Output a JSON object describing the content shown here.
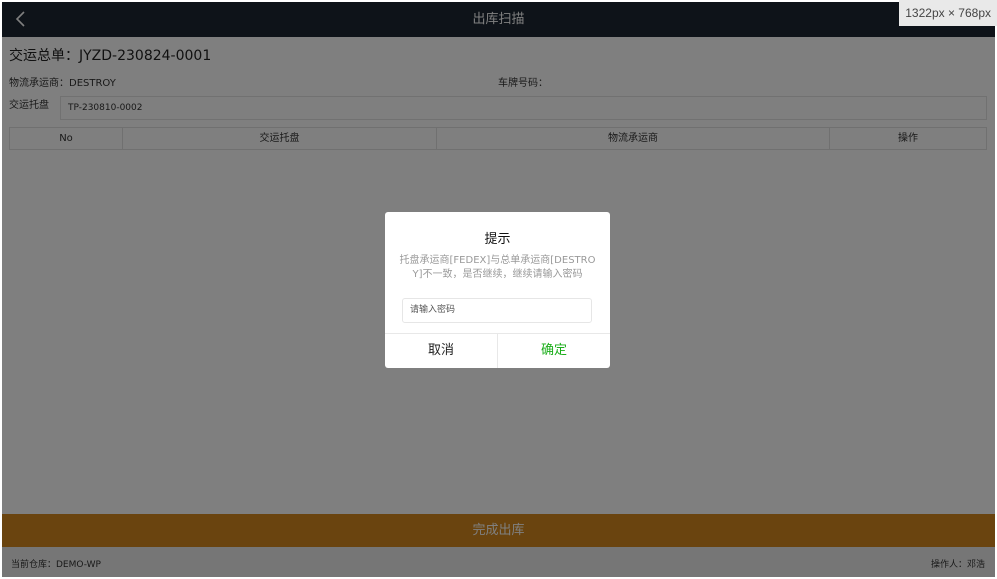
{
  "header": {
    "title": "出库扫描"
  },
  "viewport_badge": "1322px × 768px",
  "order": {
    "title": "交运总单：JYZD-230824-0001",
    "carrier": "物流承运商：DESTROY",
    "plate": "车牌号码："
  },
  "pallet": {
    "label": "交运托盘",
    "value": "TP-230810-0002"
  },
  "table": {
    "columns": [
      "No",
      "交运托盘",
      "物流承运商",
      "操作"
    ]
  },
  "complete_button": "完成出库",
  "footer": {
    "warehouse": "当前仓库：DEMO-WP",
    "operator": "操作人：邓浩"
  },
  "dialog": {
    "title": "提示",
    "message": "托盘承运商[FEDEX]与总单承运商[DESTROY]不一致，是否继续，继续请输入密码",
    "input_placeholder": "请输入密码",
    "cancel_label": "取消",
    "confirm_label": "确定"
  },
  "colors": {
    "navbar": "#1c2733",
    "accent": "#d4891e",
    "confirm": "#1aad19"
  }
}
